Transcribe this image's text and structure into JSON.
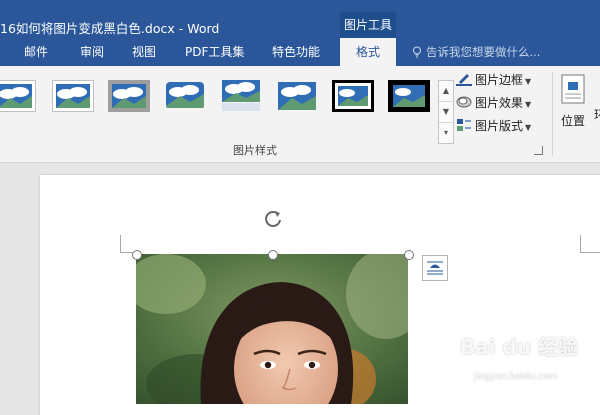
{
  "window": {
    "title": "16如何将图片变成黑白色.docx - Word",
    "context_tools": "图片工具"
  },
  "tabs": [
    {
      "label": "邮件",
      "active": false
    },
    {
      "label": "审阅",
      "active": false
    },
    {
      "label": "视图",
      "active": false
    },
    {
      "label": "PDF工具集",
      "active": false
    },
    {
      "label": "特色功能",
      "active": false
    },
    {
      "label": "格式",
      "active": true
    }
  ],
  "tell_me": {
    "placeholder": "告诉我您想要做什么..."
  },
  "ribbon": {
    "picture_styles_group": "图片样式",
    "picture_border": "图片边框",
    "picture_effects": "图片效果",
    "picture_layout": "图片版式",
    "position": "位置",
    "position_next": "环"
  },
  "watermark": {
    "brand": "Bai du 经验",
    "url": "jingyan.baidu.com"
  },
  "colors": {
    "title_bar": "#2b579a",
    "context_tab": "#1f4e8c",
    "ribbon_bg": "#f3f3f3",
    "doc_bg": "#e6e6e6"
  }
}
